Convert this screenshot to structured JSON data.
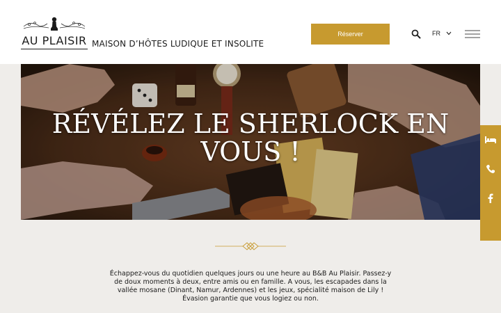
{
  "header": {
    "logo_text": "AU PLAISIR",
    "tagline": "MAISON D’HÔTES LUDIQUE ET INSOLITE",
    "reserve_label": "Réserver",
    "language": "FR"
  },
  "hero": {
    "title": "RÉVÉLEZ LE SHERLOCK EN VOUS !"
  },
  "side_actions": [
    "bed-icon",
    "phone-icon",
    "facebook-icon"
  ],
  "intro": {
    "text": "Échappez-vous du quotidien quelques jours ou une heure au B&B Au Plaisir. Passez-y de doux moments à deux, entre amis ou en famille. A vous, les escapades dans la vallée mosane (Dinant, Namur, Ardennes) et les jeux, spécialité maison de Lily ! Évasion garantie que vous logiez ou non."
  },
  "colors": {
    "accent": "#c79a2f",
    "background": "#efedea",
    "header": "#ffffff"
  }
}
